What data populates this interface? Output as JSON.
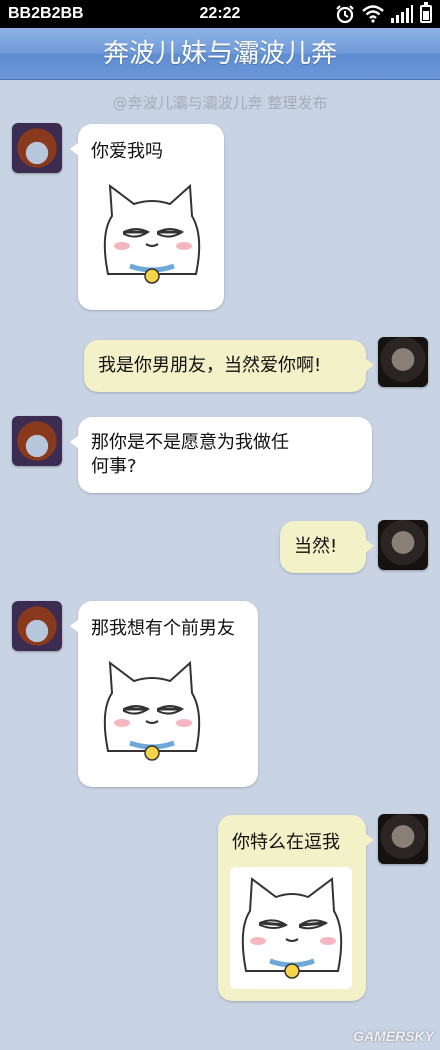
{
  "status_bar": {
    "carrier": "BB2B2BB",
    "time": "22:22",
    "icons": [
      "alarm-icon",
      "wifi-icon",
      "signal-icon",
      "battery-icon"
    ]
  },
  "header": {
    "title": "奔波儿妹与灞波儿奔"
  },
  "credit": "@奔波儿灞与灞波儿奔 整理发布",
  "messages": [
    {
      "side": "in",
      "text": "你爱我吗",
      "sticker": "cat-sticker"
    },
    {
      "side": "out",
      "text": "我是你男朋友，当然爱你啊!"
    },
    {
      "side": "in",
      "text": "那你是不是愿意为我做任何事?"
    },
    {
      "side": "out",
      "text": "当然!"
    },
    {
      "side": "in",
      "text": "那我想有个前男友",
      "sticker": "cat-sticker"
    },
    {
      "side": "out",
      "text": "你特么在逗我",
      "sticker": "cat-sticker"
    }
  ],
  "watermark": "GAMERSKY",
  "colors": {
    "background": "#c8d3e3",
    "header": "#6f9ad8",
    "incoming_bubble": "#ffffff",
    "outgoing_bubble": "#f3f1c8"
  }
}
